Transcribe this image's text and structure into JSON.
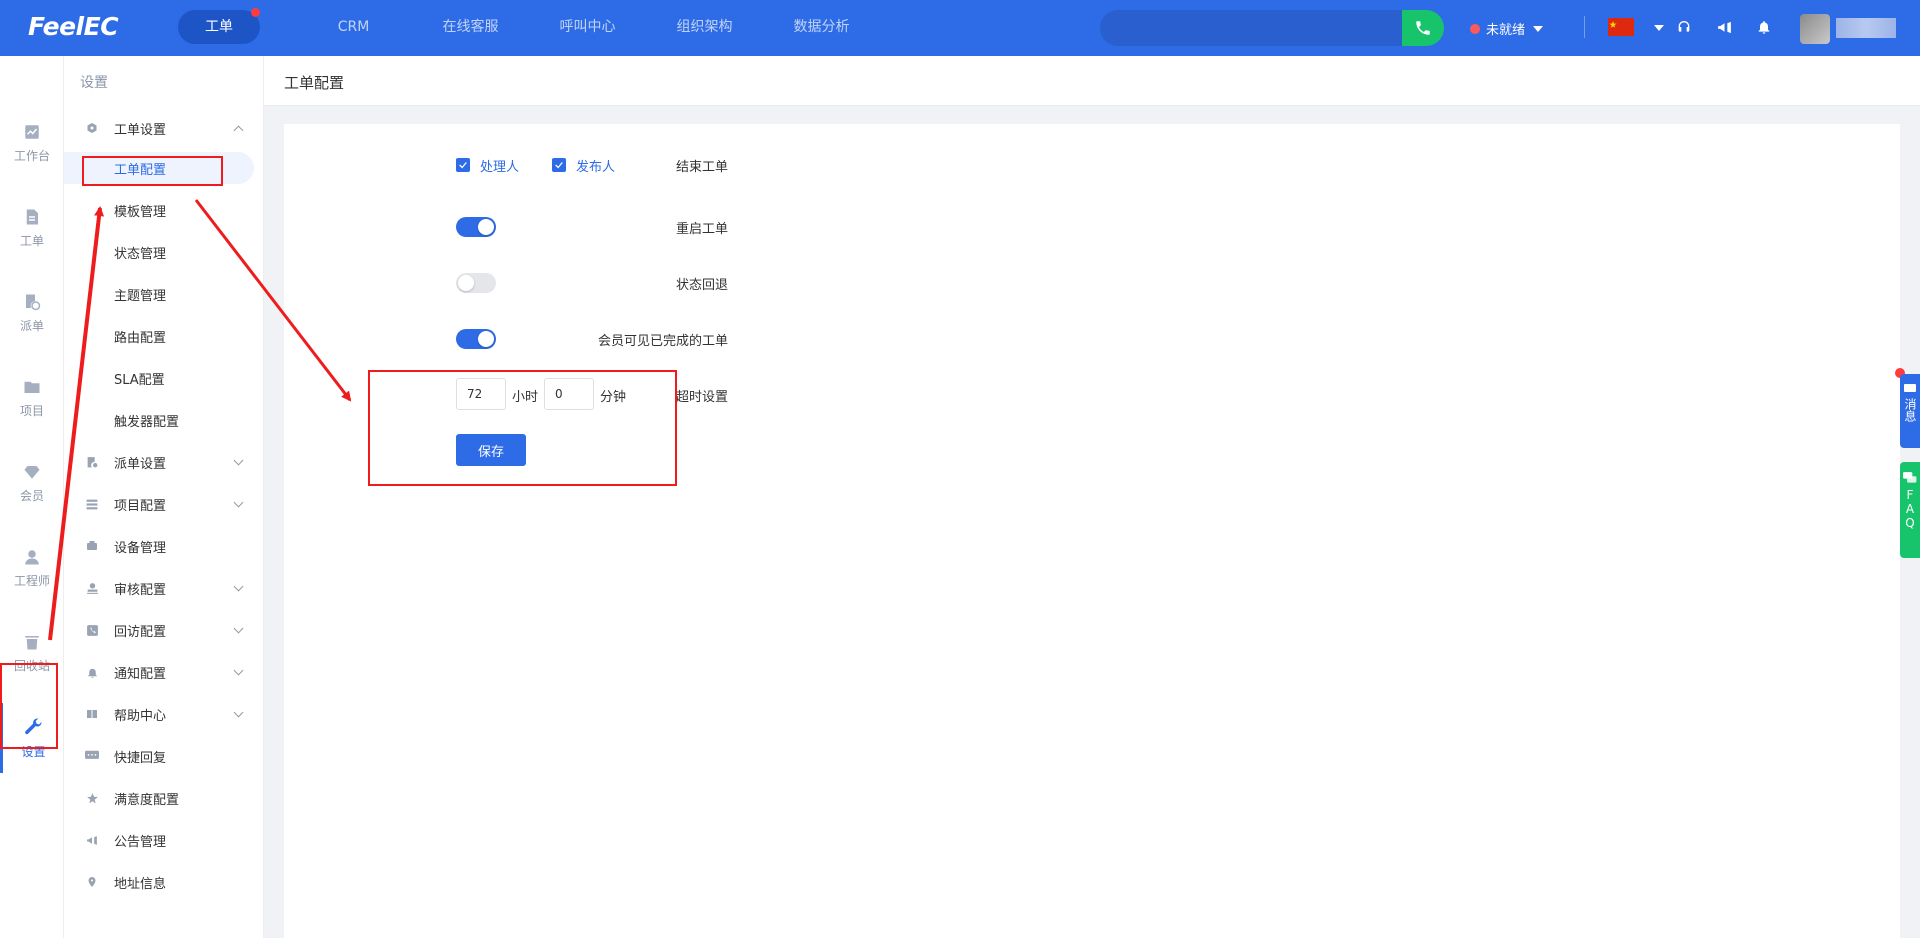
{
  "app": {
    "logo": "FeelEC",
    "brand_color": "#2e6be6",
    "accent_green": "#18c46b",
    "alert_red": "#ee1c1c"
  },
  "topnav": {
    "items": [
      {
        "label": "工单",
        "active": true,
        "has_dot": true
      },
      {
        "label": "CRM",
        "active": false
      },
      {
        "label": "在线客服",
        "active": false
      },
      {
        "label": "呼叫中心",
        "active": false
      },
      {
        "label": "组织架构",
        "active": false
      },
      {
        "label": "数据分析",
        "active": false
      }
    ],
    "status_label": "未就绪"
  },
  "rail": {
    "items": [
      {
        "label": "工作台",
        "icon": "chart-icon"
      },
      {
        "label": "工单",
        "icon": "document-icon"
      },
      {
        "label": "派单",
        "icon": "dispatch-icon"
      },
      {
        "label": "项目",
        "icon": "folder-icon"
      },
      {
        "label": "会员",
        "icon": "diamond-icon"
      },
      {
        "label": "工程师",
        "icon": "engineer-icon"
      },
      {
        "label": "回收站",
        "icon": "trash-icon"
      },
      {
        "label": "设置",
        "icon": "wrench-icon",
        "active": true
      }
    ]
  },
  "sidebar": {
    "title": "设置",
    "groups": [
      {
        "label": "工单设置",
        "icon": "hexagon-icon",
        "expanded": true
      },
      {
        "label": "派单设置",
        "icon": "dispatch-icon"
      },
      {
        "label": "项目配置",
        "icon": "list-icon"
      },
      {
        "label": "设备管理",
        "icon": "device-icon"
      },
      {
        "label": "审核配置",
        "icon": "stamp-icon"
      },
      {
        "label": "回访配置",
        "icon": "phone-icon"
      },
      {
        "label": "通知配置",
        "icon": "bell-icon"
      },
      {
        "label": "帮助中心",
        "icon": "book-icon"
      },
      {
        "label": "快捷回复",
        "icon": "chat-icon"
      },
      {
        "label": "满意度配置",
        "icon": "star-icon"
      },
      {
        "label": "公告管理",
        "icon": "megaphone-icon"
      },
      {
        "label": "地址信息",
        "icon": "location-icon"
      }
    ],
    "sub_items": [
      {
        "label": "工单配置",
        "active": true
      },
      {
        "label": "模板管理"
      },
      {
        "label": "状态管理"
      },
      {
        "label": "主题管理"
      },
      {
        "label": "路由配置"
      },
      {
        "label": "SLA配置"
      },
      {
        "label": "触发器配置"
      }
    ]
  },
  "breadcrumb": "工单配置",
  "form": {
    "close_ticket": {
      "label": "结束工单",
      "options": [
        "处理人",
        "发布人"
      ],
      "checked": [
        true,
        true
      ]
    },
    "reopen_ticket": {
      "label": "重启工单",
      "enabled": true
    },
    "status_rollback": {
      "label": "状态回退",
      "enabled": false
    },
    "member_visible": {
      "label": "会员可见已完成的工单",
      "enabled": true
    },
    "timeout": {
      "label": "超时设置",
      "hours": "72",
      "hours_unit": "小时",
      "minutes": "0",
      "minutes_unit": "分钟"
    },
    "save_label": "保存"
  },
  "floating": {
    "message_label": "消息",
    "faq_label": "FAQ"
  }
}
